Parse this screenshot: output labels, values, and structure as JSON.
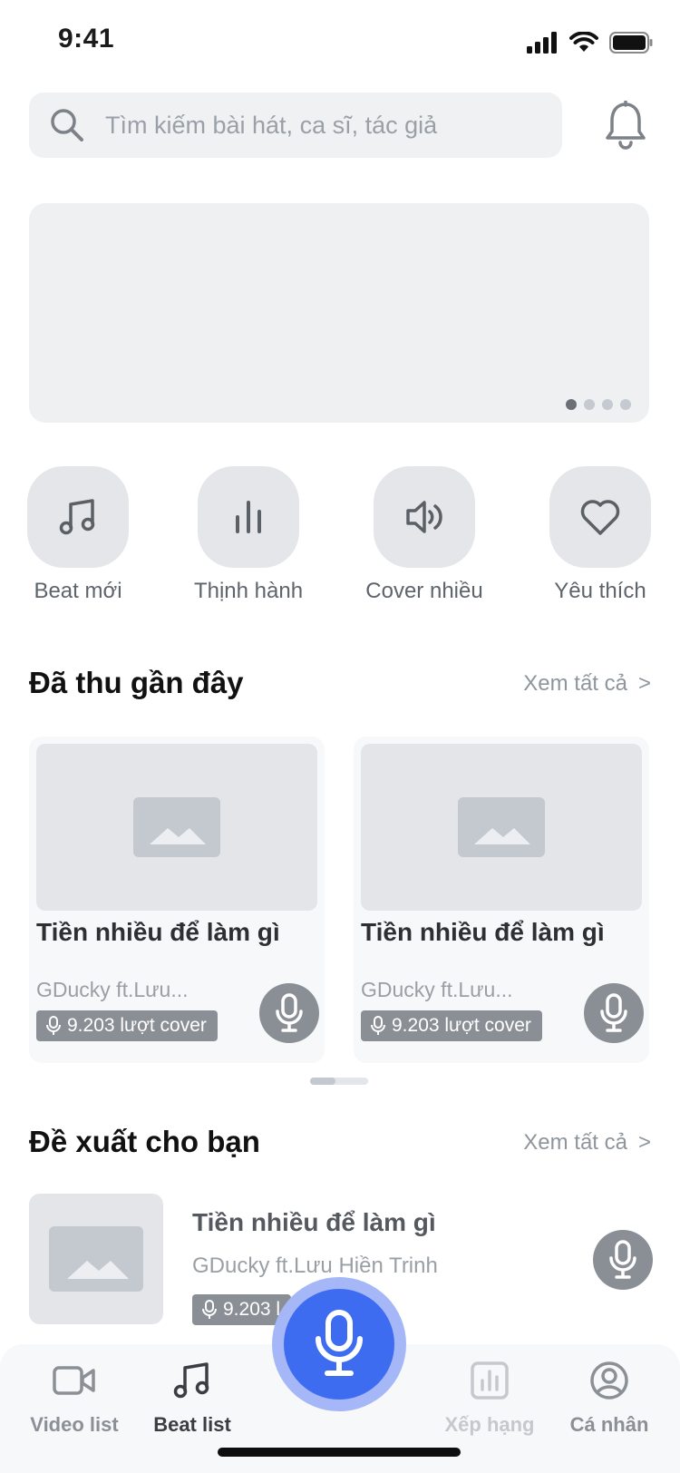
{
  "status_bar": {
    "time": "9:41",
    "icons": [
      "cellular-signal-icon",
      "wifi-icon",
      "battery-icon"
    ]
  },
  "search": {
    "placeholder": "Tìm kiếm bài hát, ca sĩ, tác giả",
    "icon": "search-icon"
  },
  "notification": {
    "icon": "bell-icon"
  },
  "banner": {
    "page_count": 4,
    "active_page": 1
  },
  "categories": [
    {
      "label": "Beat mới",
      "icon": "music-note-icon"
    },
    {
      "label": "Thịnh hành",
      "icon": "bar-chart-icon"
    },
    {
      "label": "Cover nhiều",
      "icon": "speaker-icon"
    },
    {
      "label": "Yêu thích",
      "icon": "heart-icon"
    }
  ],
  "recent": {
    "title": "Đã thu gần đây",
    "see_all": "Xem tất cả",
    "see_all_arrow": ">",
    "items": [
      {
        "song": "Tiền nhiều để làm gì",
        "artist": "GDucky ft.Lưu...",
        "covers": "9.203 lượt cover"
      },
      {
        "song": "Tiền nhiều để làm gì",
        "artist": "GDucky ft.Lưu...",
        "covers": "9.203 lượt cover"
      }
    ]
  },
  "suggested": {
    "title": "Đề xuất cho bạn",
    "see_all": "Xem tất cả",
    "see_all_arrow": ">",
    "items": [
      {
        "song": "Tiền nhiều để làm gì",
        "artist": "GDucky ft.Lưu Hiền Trinh",
        "covers": "9.203 l"
      }
    ]
  },
  "tab_bar": {
    "tabs": [
      {
        "label": "Video list",
        "icon": "video-camera-icon",
        "state": "normal"
      },
      {
        "label": "Beat list",
        "icon": "music-note-icon",
        "state": "active"
      },
      {
        "label": "Xếp hạng",
        "icon": "ranking-chart-icon",
        "state": "faded"
      },
      {
        "label": "Cá nhân",
        "icon": "user-circle-icon",
        "state": "normal"
      }
    ],
    "center_button": {
      "icon": "microphone-icon"
    }
  },
  "colors": {
    "accent_blue": "#3E6CF1",
    "accent_ring": "#A5B7F7",
    "badge_gray": "#8A8F96",
    "tile_gray": "#E4E6EA",
    "background": "#FFFFFF"
  }
}
